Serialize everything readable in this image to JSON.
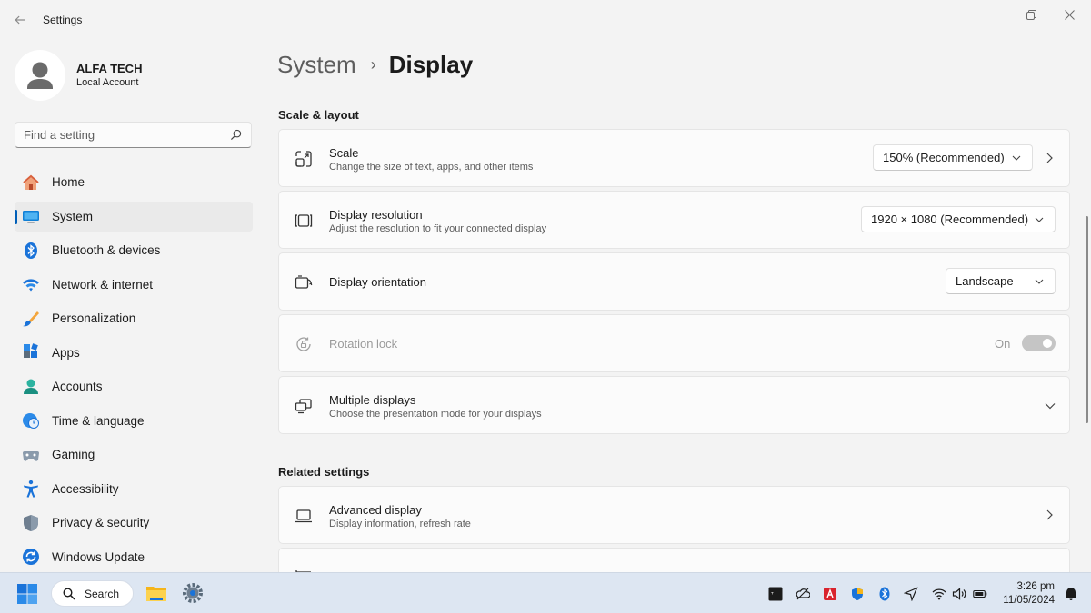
{
  "window": {
    "app_title": "Settings"
  },
  "profile": {
    "name": "ALFA TECH",
    "account_type": "Local Account"
  },
  "search": {
    "placeholder": "Find a setting"
  },
  "sidebar": {
    "items": [
      {
        "label": "Home",
        "icon": "home-icon",
        "selected": false
      },
      {
        "label": "System",
        "icon": "system-icon",
        "selected": true
      },
      {
        "label": "Bluetooth & devices",
        "icon": "bluetooth-icon",
        "selected": false
      },
      {
        "label": "Network & internet",
        "icon": "wifi-icon",
        "selected": false
      },
      {
        "label": "Personalization",
        "icon": "brush-icon",
        "selected": false
      },
      {
        "label": "Apps",
        "icon": "apps-icon",
        "selected": false
      },
      {
        "label": "Accounts",
        "icon": "accounts-icon",
        "selected": false
      },
      {
        "label": "Time & language",
        "icon": "globe-clock-icon",
        "selected": false
      },
      {
        "label": "Gaming",
        "icon": "gamepad-icon",
        "selected": false
      },
      {
        "label": "Accessibility",
        "icon": "accessibility-icon",
        "selected": false
      },
      {
        "label": "Privacy & security",
        "icon": "shield-icon",
        "selected": false
      },
      {
        "label": "Windows Update",
        "icon": "update-icon",
        "selected": false
      }
    ]
  },
  "breadcrumb": {
    "parent": "System",
    "separator": "›",
    "current": "Display"
  },
  "scale_layout": {
    "title": "Scale & layout",
    "scale": {
      "title": "Scale",
      "description": "Change the size of text, apps, and other items",
      "value": "150% (Recommended)"
    },
    "resolution": {
      "title": "Display resolution",
      "description": "Adjust the resolution to fit your connected display",
      "value": "1920 × 1080 (Recommended)"
    },
    "orientation": {
      "title": "Display orientation",
      "value": "Landscape"
    },
    "rotation_lock": {
      "title": "Rotation lock",
      "state_label": "On",
      "enabled": false
    },
    "multiple_displays": {
      "title": "Multiple displays",
      "description": "Choose the presentation mode for your displays"
    }
  },
  "related": {
    "title": "Related settings",
    "advanced_display": {
      "title": "Advanced display",
      "description": "Display information, refresh rate"
    }
  },
  "taskbar": {
    "search_label": "Search",
    "time": "3:26 pm",
    "date": "11/05/2024"
  },
  "colors": {
    "accent": "#005fb8",
    "taskbar": "#dde6f2",
    "background": "#f3f3f3"
  }
}
